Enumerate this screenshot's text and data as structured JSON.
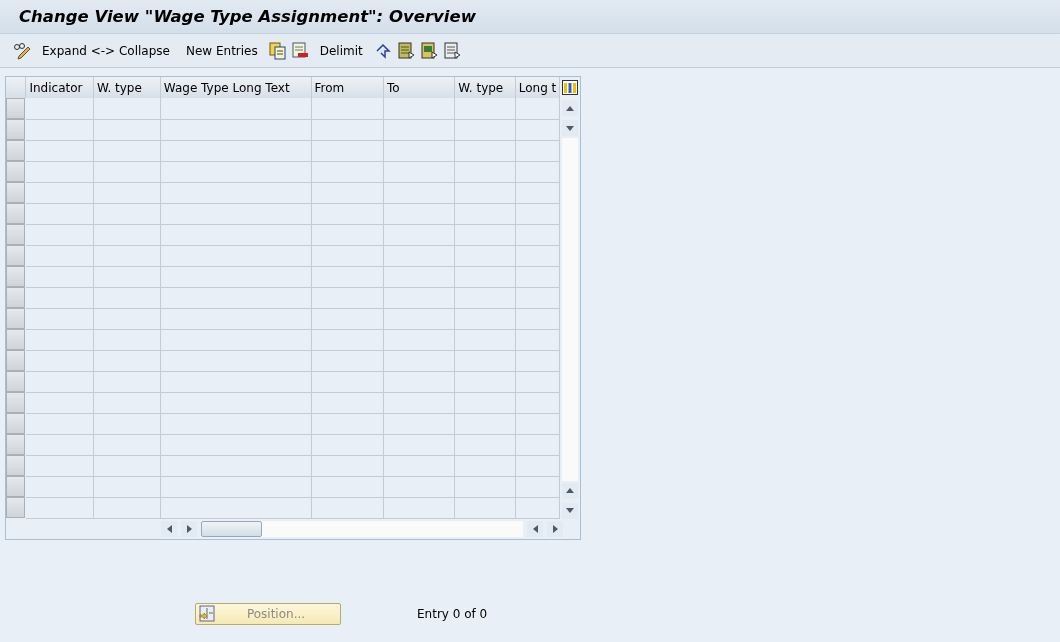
{
  "window": {
    "title": "Change View \"Wage Type Assignment\": Overview"
  },
  "toolbar": [
    {
      "kind": "icon"
    },
    {
      "kind": "text",
      "label": "Expand <-> Collapse"
    },
    {
      "kind": "text",
      "label": "New Entries"
    },
    {
      "kind": "icon"
    },
    {
      "kind": "icon"
    },
    {
      "kind": "text",
      "label": "Delimit"
    },
    {
      "kind": "icon"
    },
    {
      "kind": "icon"
    },
    {
      "kind": "icon"
    },
    {
      "kind": "icon"
    }
  ],
  "table": {
    "columns": [
      "Indicator",
      "W. type",
      "Wage Type Long Text",
      "From",
      "To",
      "W. type",
      "Long t"
    ]
  },
  "footer": {
    "position_button": {
      "label": "Position...",
      "disabled": true
    },
    "entry_text": "Entry 0 of 0"
  }
}
